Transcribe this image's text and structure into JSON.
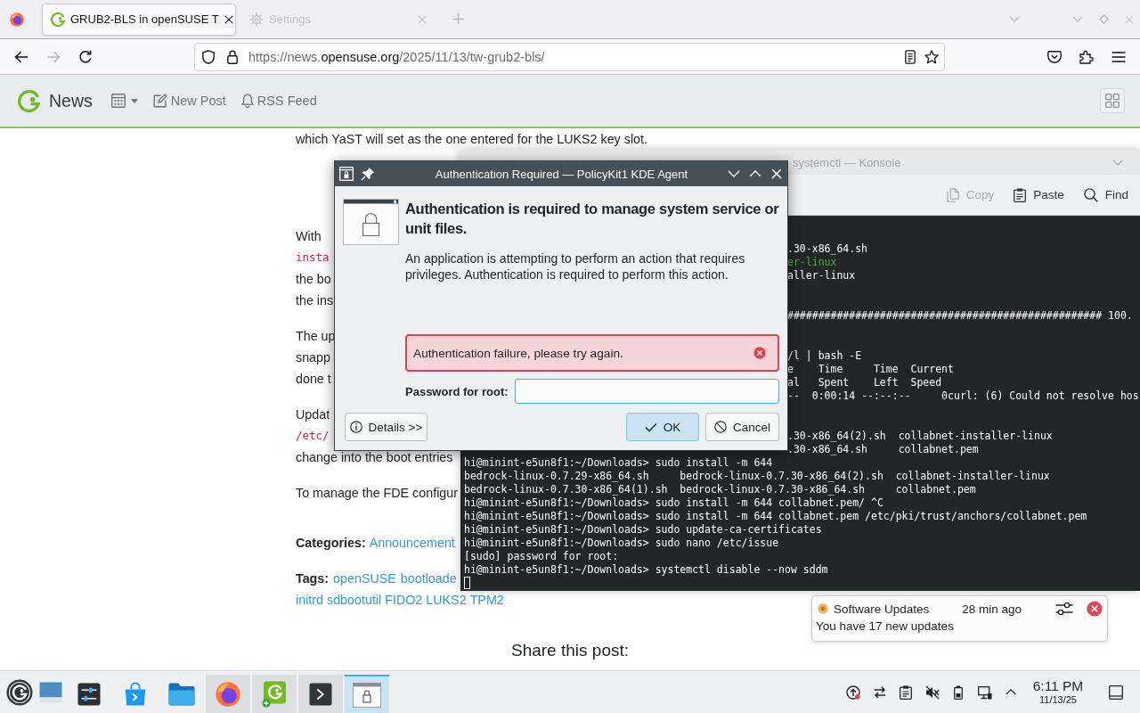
{
  "browser": {
    "tabs": [
      {
        "title": "GRUB2-BLS in openSUSE T",
        "kind": "article",
        "selected": true
      },
      {
        "title": "Settings",
        "kind": "settings",
        "selected": false
      }
    ],
    "nav_buttons": [
      {
        "kind": "back",
        "disabled": false
      },
      {
        "kind": "forward",
        "disabled": true
      },
      {
        "kind": "reload",
        "disabled": false
      }
    ],
    "url": {
      "prefix": "https://news.",
      "domain": "opensuse.org",
      "path": "/2025/11/13/tw-grub2-bls/"
    }
  },
  "site_header": {
    "title": "News",
    "nav": [
      {
        "kind": "calendar"
      },
      {
        "kind": "edit",
        "label": "New Post"
      },
      {
        "kind": "bell",
        "label": "RSS Feed"
      }
    ]
  },
  "article": {
    "intro_line": "which YaST will set as the one entered for the LUKS2 key slot.",
    "paragraphs": [
      {
        "lines": [
          {
            "text": "With",
            "kind": "text"
          },
          {
            "text": "insta",
            "kind": "code"
          },
          {
            "text": "the bo",
            "kind": "text"
          },
          {
            "text": "the ins",
            "kind": "text"
          }
        ]
      },
      {
        "lines": [
          {
            "text": "The up",
            "kind": "text"
          },
          {
            "text": "snapp",
            "kind": "text"
          },
          {
            "text": "done t",
            "kind": "text"
          }
        ]
      },
      {
        "lines": [
          {
            "text": "Updat",
            "kind": "text"
          },
          {
            "text": "/etc/",
            "kind": "code"
          },
          {
            "text": "change into the boot entries",
            "kind": "text"
          }
        ]
      },
      {
        "lines": [
          {
            "text": "To manage the FDE configur",
            "kind": "text"
          }
        ]
      }
    ],
    "categories": {
      "label": "Categories:",
      "links": [
        "Announcement"
      ]
    },
    "tags": {
      "label": "Tags:",
      "rows": [
        {
          "links": [
            "openSUSE",
            "bootloade"
          ]
        },
        {
          "links": [
            "initrd",
            "sdbootutil",
            "FIDO2",
            "LUKS2",
            "TPM2"
          ]
        }
      ]
    },
    "share_heading": "Share this post:"
  },
  "konsole": {
    "title": "systemctl — Konsole",
    "toolbar": [
      {
        "label": "Copy",
        "kind": "copy",
        "disabled": true
      },
      {
        "label": "Paste",
        "kind": "paste",
        "disabled": false
      },
      {
        "label": "Find",
        "kind": "find",
        "disabled": false
      }
    ],
    "covered_groups": [
      {
        "lines": [
          {
            "text": ".30-x86_64.sh",
            "kind": "plain"
          },
          {
            "text": "er-linux",
            "kind": "exec"
          },
          {
            "text": "aller-linux",
            "kind": "plain"
          }
        ]
      },
      {
        "lines": [
          {
            "text": "################################################### 100.",
            "kind": "plain"
          }
        ]
      },
      {
        "lines": [
          {
            "text": "/l | bash -E",
            "kind": "plain"
          },
          {
            "text": "e    Time     Time  Current",
            "kind": "plain"
          },
          {
            "text": "al   Spent    Left  Speed",
            "kind": "plain"
          },
          {
            "text": "--  0:00:14 --:--:--     0curl: (6) Could not resolve hos",
            "kind": "plain"
          }
        ]
      },
      {
        "lines": [
          {
            "text": ".30-x86_64(2).sh  collabnet-installer-linux",
            "kind": "plain"
          },
          {
            "text": ".30-x86_64.sh     collabnet.pem",
            "kind": "plain"
          }
        ]
      }
    ],
    "lines": [
      {
        "text": "hi@minint-e5un8f1:~/Downloads> sudo install -m 644",
        "kind": "plain"
      },
      {
        "text": "bedrock-linux-0.7.29-x86_64.sh     bedrock-linux-0.7.30-x86_64(2).sh  collabnet-installer-linux",
        "kind": "plain"
      },
      {
        "text": "bedrock-linux-0.7.30-x86_64(1).sh  bedrock-linux-0.7.30-x86_64.sh     collabnet.pem",
        "kind": "plain"
      },
      {
        "text": "hi@minint-e5un8f1:~/Downloads> sudo install -m 644 collabnet.pem/ ^C",
        "kind": "plain"
      },
      {
        "text": "hi@minint-e5un8f1:~/Downloads> sudo install -m 644 collabnet.pem /etc/pki/trust/anchors/collabnet.pem",
        "kind": "plain"
      },
      {
        "text": "hi@minint-e5un8f1:~/Downloads> sudo update-ca-certificates",
        "kind": "plain"
      },
      {
        "text": "hi@minint-e5un8f1:~/Downloads> sudo nano /etc/issue",
        "kind": "plain"
      },
      {
        "text": "[sudo] password for root:",
        "kind": "plain"
      },
      {
        "text": "hi@minint-e5un8f1:~/Downloads> systemctl disable --now sddm",
        "kind": "plain"
      }
    ],
    "cursor": true
  },
  "dialog": {
    "title": "Authentication Required — PolicyKit1 KDE Agent",
    "heading": "Authentication is required to manage system service or unit files.",
    "description": "An application is attempting to perform an action that requires privileges. Authentication is required to perform this action.",
    "error": "Authentication failure, please try again.",
    "password": {
      "label": "Password for root:",
      "focused": true
    },
    "buttons": [
      {
        "label": "Details >>",
        "kind": "info",
        "default": false
      },
      {
        "label": "OK",
        "kind": "ok",
        "default": true
      },
      {
        "label": "Cancel",
        "kind": "cancel",
        "default": false
      }
    ]
  },
  "notification": {
    "app": "Software Updates",
    "time": "28 min ago",
    "body": "You have 17 new updates"
  },
  "taskbar": {
    "tasks": [
      {
        "kind": "settings",
        "running": false,
        "selected": false
      },
      {
        "kind": "store",
        "running": false,
        "selected": false
      },
      {
        "kind": "folder",
        "running": false,
        "selected": false
      },
      {
        "kind": "browser",
        "running": true,
        "selected": false
      },
      {
        "kind": "news",
        "running": true,
        "selected": false
      },
      {
        "kind": "terminal",
        "running": true,
        "selected": false
      },
      {
        "kind": "dialog",
        "running": true,
        "selected": true
      }
    ],
    "muted": true,
    "clock": {
      "time": "6:11 PM",
      "date": "11/13/25"
    }
  }
}
